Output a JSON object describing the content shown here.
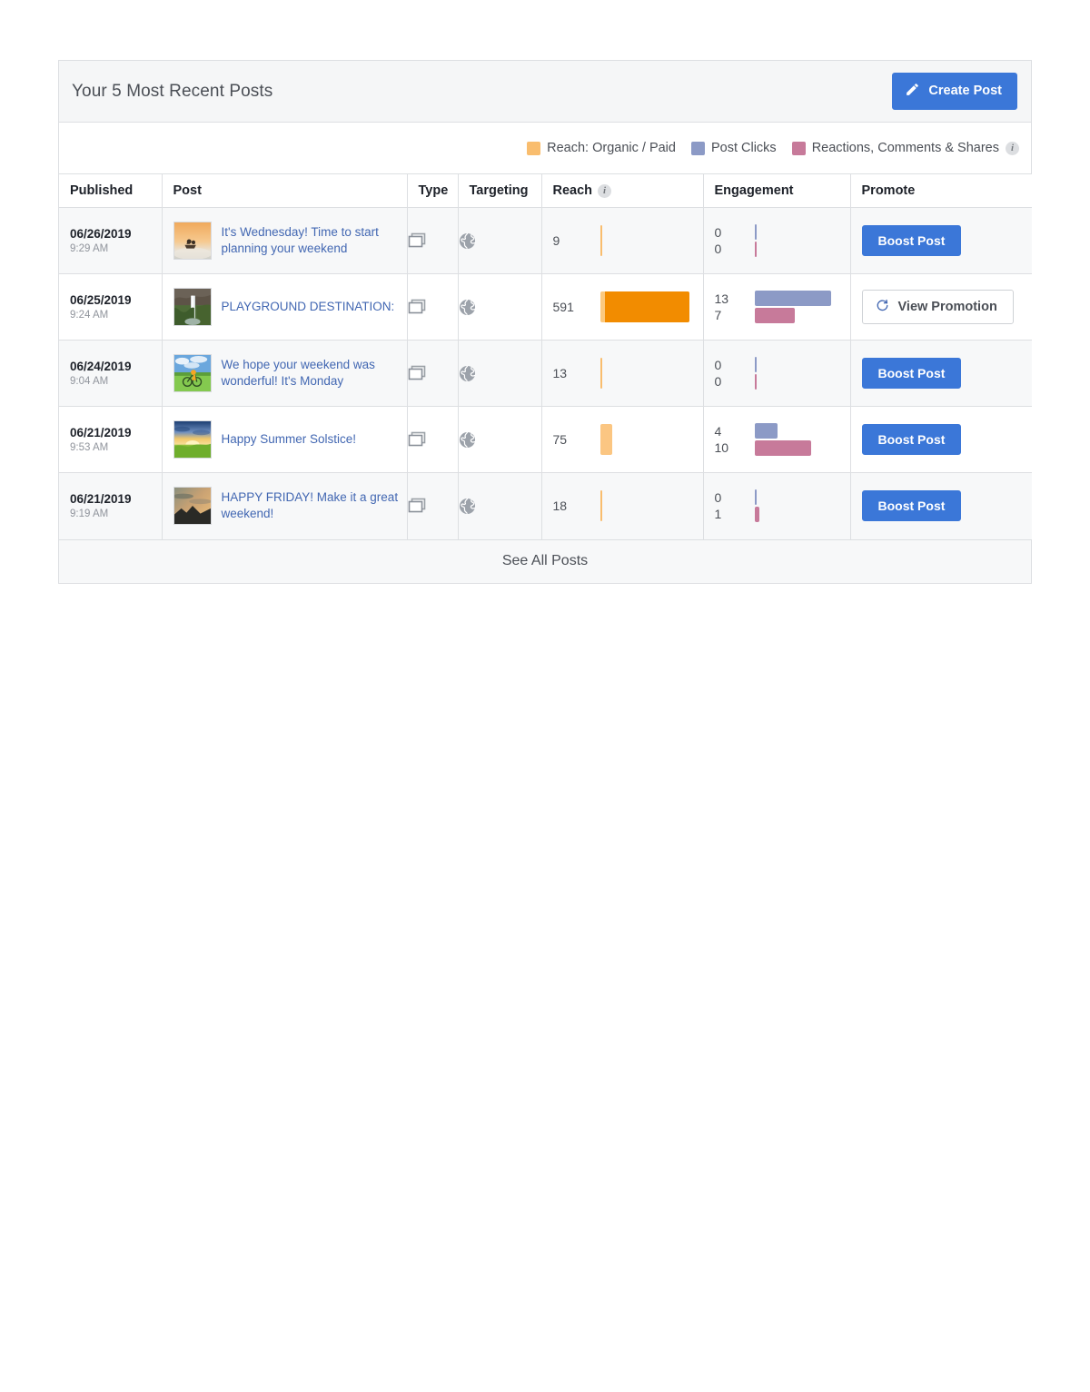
{
  "card": {
    "title": "Your 5 Most Recent Posts",
    "create_button": {
      "label": "Create Post",
      "icon": "pencil-icon",
      "color": "#3b77d8"
    },
    "footer_label": "See All Posts"
  },
  "legend": {
    "info_icon": "i",
    "items": [
      {
        "label": "Reach: Organic / Paid",
        "color": "#f9bd6e",
        "icon": "legend-swatch-reach"
      },
      {
        "label": "Post Clicks",
        "color": "#8c9ac6",
        "icon": "legend-swatch-clicks"
      },
      {
        "label": "Reactions, Comments & Shares",
        "color": "#c77a9a",
        "icon": "legend-swatch-reactions"
      }
    ]
  },
  "table": {
    "columns": [
      {
        "key": "published",
        "label": "Published"
      },
      {
        "key": "post",
        "label": "Post"
      },
      {
        "key": "type",
        "label": "Type"
      },
      {
        "key": "targeting",
        "label": "Targeting"
      },
      {
        "key": "reach",
        "label": "Reach",
        "has_info_icon": true
      },
      {
        "key": "engagement",
        "label": "Engagement"
      },
      {
        "key": "promote",
        "label": "Promote"
      }
    ],
    "rows": [
      {
        "date": "06/26/2019",
        "time": "9:29 AM",
        "title": "It's Wednesday! Time to start planning your weekend",
        "thumb": "sunset-boat-photo",
        "type_icon": "multi-photo-icon",
        "targeting_icon": "globe-icon",
        "reach": "9",
        "engagement_clicks": "0",
        "engagement_reactions": "0",
        "promote_label": "Boost Post",
        "promote_kind": "boost"
      },
      {
        "date": "06/25/2019",
        "time": "9:24 AM",
        "title": "PLAYGROUND DESTINATION:",
        "thumb": "waterfall-photo",
        "type_icon": "multi-photo-icon",
        "targeting_icon": "globe-icon",
        "reach": "591",
        "engagement_clicks": "13",
        "engagement_reactions": "7",
        "promote_label": "View Promotion",
        "promote_kind": "view",
        "promote_icon": "refresh-icon"
      },
      {
        "date": "06/24/2019",
        "time": "9:04 AM",
        "title": "We hope your weekend was wonderful! It's Monday",
        "thumb": "cyclist-field-photo",
        "type_icon": "multi-photo-icon",
        "targeting_icon": "globe-icon",
        "reach": "13",
        "engagement_clicks": "0",
        "engagement_reactions": "0",
        "promote_label": "Boost Post",
        "promote_kind": "boost"
      },
      {
        "date": "06/21/2019",
        "time": "9:53 AM",
        "title": "Happy Summer Solstice!",
        "thumb": "sunrise-field-photo",
        "type_icon": "multi-photo-icon",
        "targeting_icon": "globe-icon",
        "reach": "75",
        "engagement_clicks": "4",
        "engagement_reactions": "10",
        "promote_label": "Boost Post",
        "promote_kind": "boost"
      },
      {
        "date": "06/21/2019",
        "time": "9:19 AM",
        "title": "HAPPY FRIDAY! Make it a great weekend!",
        "thumb": "dusk-mountains-photo",
        "type_icon": "multi-photo-icon",
        "targeting_icon": "globe-icon",
        "reach": "18",
        "engagement_clicks": "0",
        "engagement_reactions": "1",
        "promote_label": "Boost Post",
        "promote_kind": "boost"
      }
    ]
  },
  "chart_data": {
    "type": "bar",
    "title": "Your 5 Most Recent Posts",
    "orientation": "horizontal",
    "categories": [
      "06/26/2019 9:29 AM",
      "06/25/2019 9:24 AM",
      "06/24/2019 9:04 AM",
      "06/21/2019 9:53 AM",
      "06/21/2019 9:19 AM"
    ],
    "series": [
      {
        "name": "Reach: Organic",
        "color": "#f9bd6e",
        "values": [
          9,
          18,
          13,
          75,
          18
        ]
      },
      {
        "name": "Reach: Paid",
        "color": "#f28c00",
        "values": [
          0,
          573,
          0,
          0,
          0
        ]
      },
      {
        "name": "Post Clicks",
        "color": "#8c9ac6",
        "values": [
          0,
          13,
          0,
          4,
          0
        ]
      },
      {
        "name": "Reactions, Comments & Shares",
        "color": "#c77a9a",
        "values": [
          0,
          7,
          0,
          10,
          1
        ]
      }
    ],
    "reach_totals": [
      9,
      591,
      13,
      75,
      18
    ],
    "xlabel": "",
    "ylabel": "",
    "grid": false,
    "legend_position": "top-right"
  },
  "bar_pixels": {
    "reach_max_width": 98,
    "eng_max_width": 88,
    "rows": [
      {
        "reach_organic": 2,
        "reach_paid": 0,
        "clicks": 2,
        "reactions": 2
      },
      {
        "reach_organic": 5,
        "reach_paid": 93,
        "clicks": 84,
        "reactions": 44
      },
      {
        "reach_organic": 2,
        "reach_paid": 0,
        "clicks": 2,
        "reactions": 2
      },
      {
        "reach_organic": 13,
        "reach_paid": 0,
        "clicks": 25,
        "reactions": 62
      },
      {
        "reach_organic": 2,
        "reach_paid": 0,
        "clicks": 2,
        "reactions": 5
      }
    ]
  }
}
